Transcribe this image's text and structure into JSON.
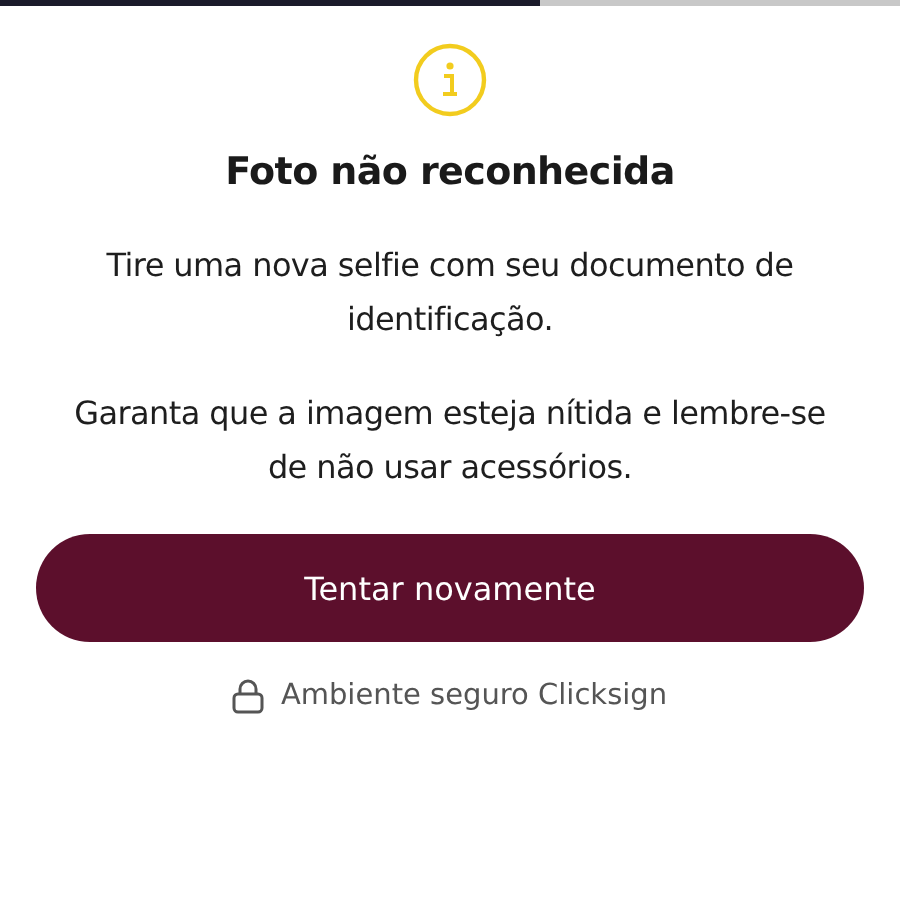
{
  "progress": {
    "level": 0.6
  },
  "title": "Foto não reconhecida",
  "paragraphs": [
    "Tire uma nova selfie com seu documento de identificação.",
    "Garanta que a imagem esteja nítida e lembre-se de não usar acessórios."
  ],
  "button": {
    "label": "Tentar novamente"
  },
  "footer": {
    "text": "Ambiente seguro Clicksign"
  }
}
